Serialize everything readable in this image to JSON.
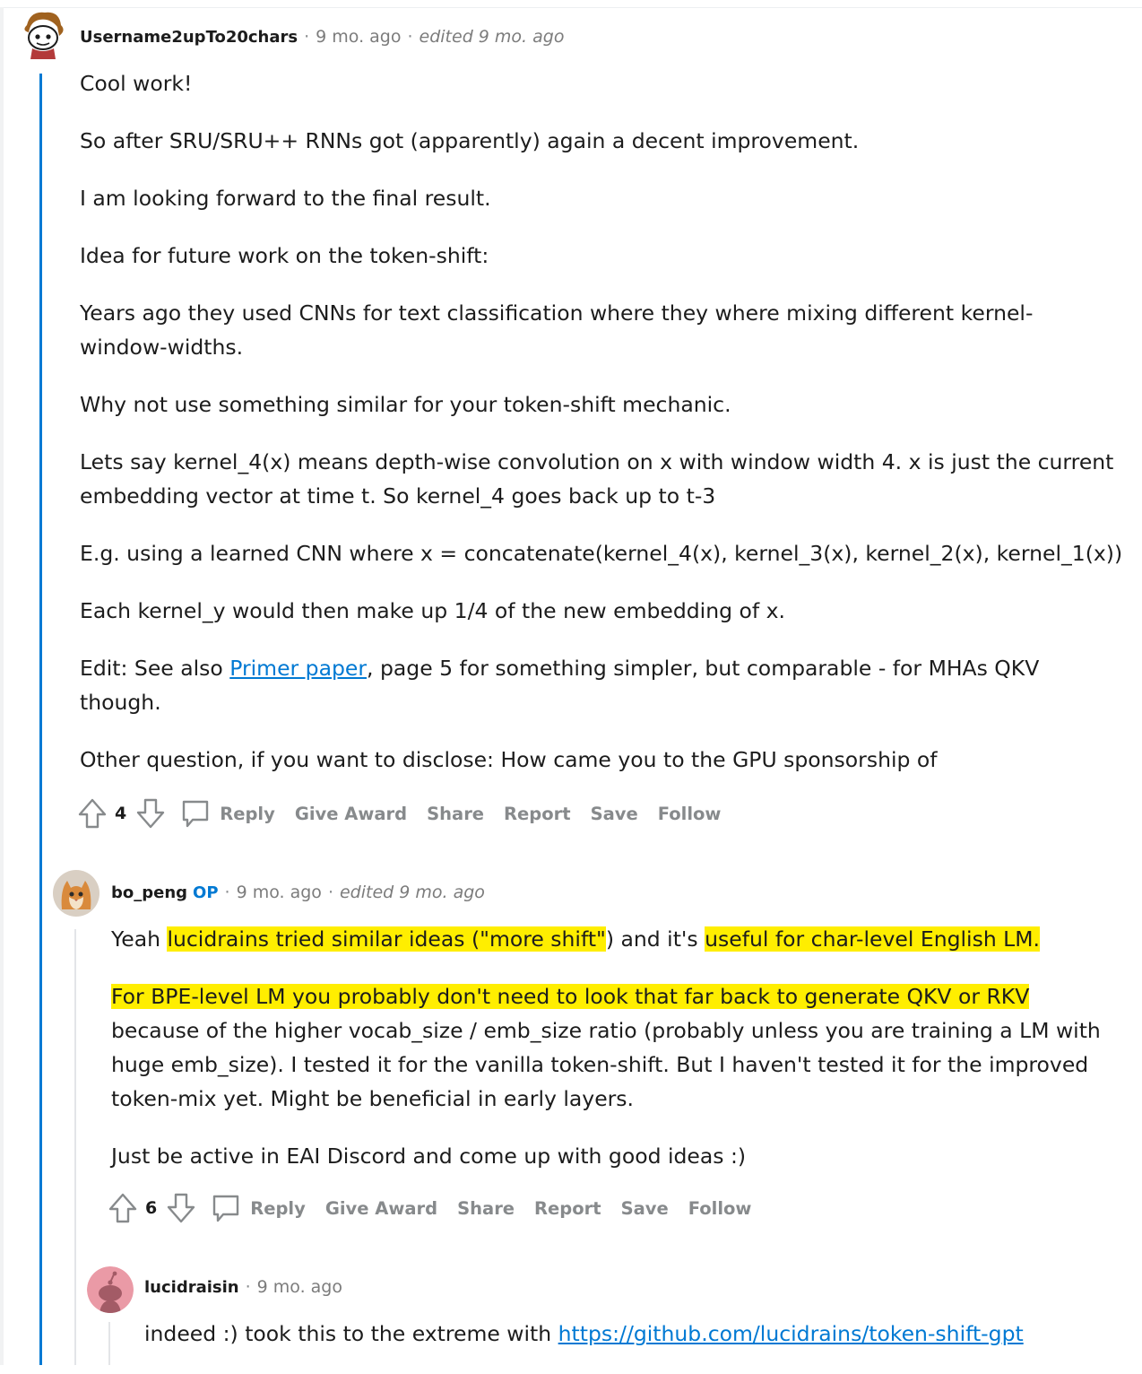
{
  "comments": [
    {
      "author": "Username2upTo20chars",
      "age": "9 mo. ago",
      "edited": "edited 9 mo. ago",
      "paragraphs": [
        "Cool work!",
        "So after SRU/SRU++ RNNs got (apparently) again a decent improvement.",
        "I am looking forward to the final result.",
        "Idea for future work on the token-shift:",
        "Years ago they used CNNs for text classification where they where mixing different kernel-window-widths.",
        "Why not use something similar for your token-shift mechanic.",
        "Lets say kernel_4(x) means depth-wise convolution on x with window width 4. x is just the current embedding vector at time t. So kernel_4 goes back up to t-3",
        "E.g. using a learned CNN where x = concatenate(kernel_4(x), kernel_3(x), kernel_2(x), kernel_1(x))",
        "Each kernel_y would then make up 1/4 of the new embedding of x."
      ],
      "edit_prefix": "Edit: See also ",
      "edit_link": "Primer paper",
      "edit_suffix": ", page 5 for something simpler, but comparable - for MHAs QKV though.",
      "last_paragraph": "Other question, if you want to disclose: How came you to the GPU sponsorship of",
      "votes": "4"
    },
    {
      "author": "bo_peng",
      "badge": "OP",
      "age": "9 mo. ago",
      "edited": "edited 9 mo. ago",
      "p1_a": "Yeah ",
      "p1_h1": "lucidrains tried similar ideas (\"more shift\"",
      "p1_b": ") and it's ",
      "p1_h2": "useful for char-level English LM.",
      "p2_h": "For BPE-level LM you probably don't need to look that far back to generate QKV or RKV",
      "p2_rest": " because of the higher vocab_size / emb_size ratio (probably unless you are training a LM with huge emb_size). I tested it for the vanilla token-shift. But I haven't tested it for the improved token-mix yet. Might be beneficial in early layers.",
      "p3": "Just be active in EAI Discord and come up with good ideas :)",
      "votes": "6"
    },
    {
      "author": "lucidraisin",
      "age": "9 mo. ago",
      "text_prefix": "indeed :) took this to the extreme with ",
      "link": "https://github.com/lucidrains/token-shift-gpt"
    }
  ],
  "actions": {
    "reply": "Reply",
    "give_award": "Give Award",
    "share": "Share",
    "report": "Report",
    "save": "Save",
    "follow": "Follow"
  },
  "colors": {
    "accent": "#0079d3",
    "highlight": "#ffee00",
    "muted": "#878a8c"
  },
  "icons": [
    "snoo-avatar-icon",
    "cat-avatar-icon",
    "default-snoo-avatar-icon",
    "upvote-arrow-icon",
    "downvote-arrow-icon",
    "comment-bubble-icon"
  ]
}
